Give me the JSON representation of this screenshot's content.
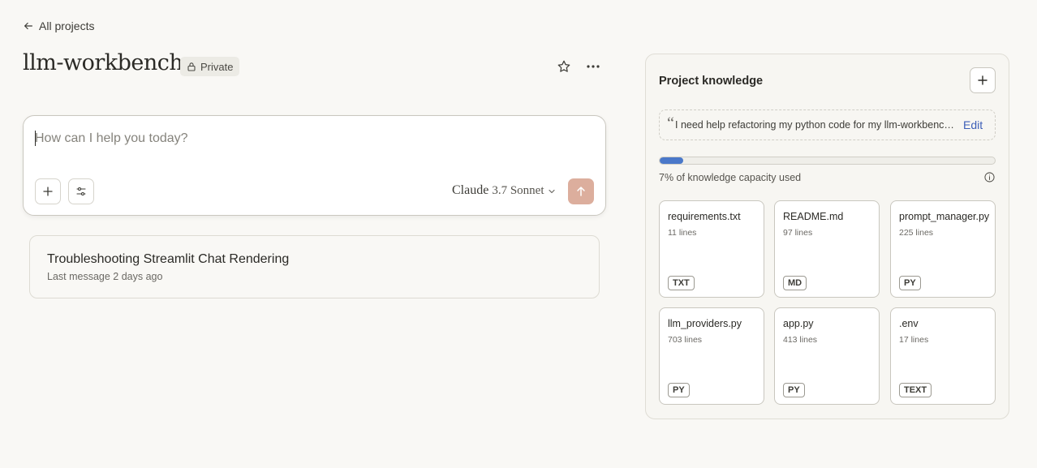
{
  "nav": {
    "back_label": "All projects"
  },
  "project": {
    "title": "llm-workbench",
    "visibility": "Private"
  },
  "composer": {
    "placeholder": "How can I help you today?",
    "model_name": "Claude",
    "model_version": "3.7 Sonnet"
  },
  "chats": [
    {
      "title": "Troubleshooting Streamlit Chat Rendering",
      "meta": "Last message 2 days ago"
    }
  ],
  "knowledge": {
    "title": "Project knowledge",
    "instructions": "I need help refactoring my python code for my llm-workbench project",
    "instructions_edit": "Edit",
    "capacity_percent": 7,
    "capacity_label": "7% of knowledge capacity used",
    "files": [
      {
        "name": "requirements.txt",
        "lines": "11 lines",
        "type": "TXT"
      },
      {
        "name": "README.md",
        "lines": "97 lines",
        "type": "MD"
      },
      {
        "name": "prompt_manager.py",
        "lines": "225 lines",
        "type": "PY"
      },
      {
        "name": "llm_providers.py",
        "lines": "703 lines",
        "type": "PY"
      },
      {
        "name": "app.py",
        "lines": "413 lines",
        "type": "PY"
      },
      {
        "name": ".env",
        "lines": "17 lines",
        "type": "TEXT"
      }
    ]
  },
  "colors": {
    "accent": "#4a78c9",
    "send_button": "#dcae9d",
    "background": "#f9f8f5"
  }
}
